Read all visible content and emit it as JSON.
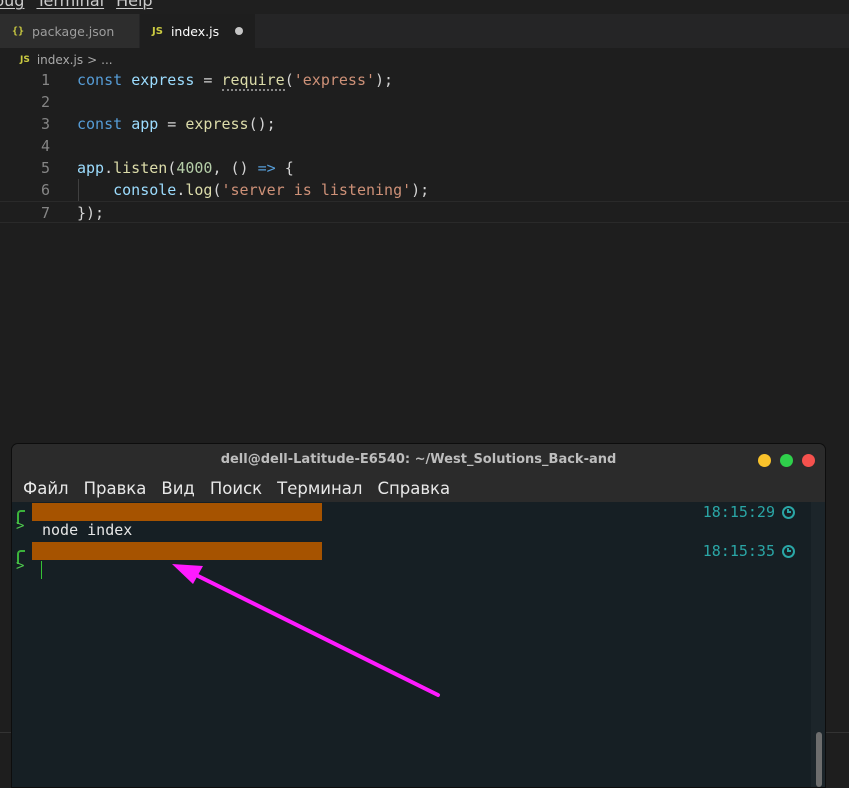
{
  "app_menu": {
    "items": [
      "bug",
      "Terminal",
      "Help"
    ]
  },
  "tabs": [
    {
      "icon": "{}",
      "label": "package.json",
      "active": false
    },
    {
      "icon": "JS",
      "label": "index.js",
      "active": true,
      "modified": true
    }
  ],
  "breadcrumb": {
    "icon": "JS",
    "file": "index.js",
    "sep": ">",
    "more": "..."
  },
  "code": {
    "line_numbers": [
      "1",
      "2",
      "3",
      "4",
      "5",
      "6",
      "7"
    ],
    "l1": {
      "kw": "const",
      "name": "express",
      "eq": " = ",
      "fn": "require",
      "open": "(",
      "str": "'express'",
      "close": ");"
    },
    "l3": {
      "kw": "const",
      "name": "app",
      "eq": " = ",
      "fn": "express",
      "rest": "();"
    },
    "l5": {
      "obj": "app",
      "dot": ".",
      "fn": "listen",
      "open": "(",
      "num": "4000",
      "mid": ", () ",
      "arrow": "=>",
      "rest": " {"
    },
    "l6": {
      "obj": "console",
      "dot": ".",
      "fn": "log",
      "open": "(",
      "str": "'server is listening'",
      "close": ");"
    },
    "l7": {
      "text": "});"
    }
  },
  "terminal": {
    "title": "dell@dell-Latitude-E6540: ~/West_Solutions_Back-and",
    "menu": [
      "Файл",
      "Правка",
      "Вид",
      "Поиск",
      "Терминал",
      "Справка"
    ],
    "entries": [
      {
        "time": "18:15:29",
        "command": "node index"
      },
      {
        "time": "18:15:35",
        "command": ""
      }
    ],
    "prompt_symbol": ">"
  },
  "colors": {
    "annotation_arrow": "#ff1aff",
    "redaction": "#a65300"
  }
}
